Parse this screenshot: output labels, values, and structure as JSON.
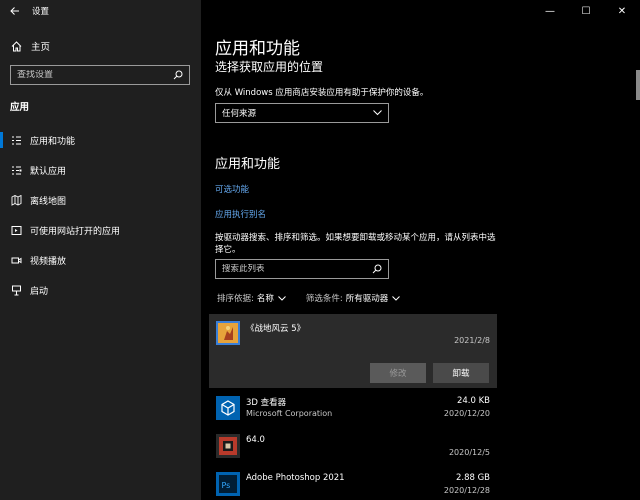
{
  "window": {
    "title": "设置",
    "back_icon": "back-arrow-icon",
    "controls": [
      "—",
      "☐",
      "✕"
    ]
  },
  "sidebar": {
    "home_label": "主页",
    "search_placeholder": "查找设置",
    "section_label": "应用",
    "items": [
      {
        "label": "应用和功能",
        "icon": "apps-list-icon",
        "selected": true
      },
      {
        "label": "默认应用",
        "icon": "default-apps-icon",
        "selected": false
      },
      {
        "label": "离线地图",
        "icon": "offline-map-icon",
        "selected": false
      },
      {
        "label": "可使用网站打开的应用",
        "icon": "website-app-icon",
        "selected": false
      },
      {
        "label": "视频播放",
        "icon": "video-icon",
        "selected": false
      },
      {
        "label": "启动",
        "icon": "startup-icon",
        "selected": false
      }
    ]
  },
  "main": {
    "title": "应用和功能",
    "source_heading": "选择获取应用的位置",
    "source_desc": "仅从 Windows 应用商店安装应用有助于保护你的设备。",
    "source_dropdown_value": "任何来源",
    "section_heading": "应用和功能",
    "links": {
      "optional_features": "可选功能",
      "app_aliases": "应用执行别名"
    },
    "list_desc": "按驱动器搜索、排序和筛选。如果想要卸载或移动某个应用，请从列表中选择它。",
    "list_search_placeholder": "搜索此列表",
    "sort_label": "排序依据:",
    "sort_value": "名称",
    "filter_label": "筛选条件:",
    "filter_value": "所有驱动器",
    "modify_button": "修改",
    "uninstall_button": "卸载",
    "apps": [
      {
        "name": "《战地风云 5》",
        "publisher": "",
        "size": "",
        "date": "2021/2/8",
        "icon": "battlefield-icon",
        "selected": true
      },
      {
        "name": "3D 查看器",
        "publisher": "Microsoft Corporation",
        "size": "24.0 KB",
        "date": "2020/12/20",
        "icon": "3d-viewer-icon",
        "selected": false
      },
      {
        "name": "64.0",
        "publisher": "",
        "size": "",
        "date": "2020/12/5",
        "icon": "generic-app-icon",
        "selected": false
      },
      {
        "name": "Adobe Photoshop 2021",
        "publisher": "",
        "size": "2.88 GB",
        "date": "2020/12/28",
        "icon": "photoshop-icon",
        "selected": false
      }
    ]
  },
  "colors": {
    "accent": "#0078d7",
    "link": "#64a8ee",
    "sidebar_bg": "#1f1f1f",
    "main_bg": "#000000"
  }
}
